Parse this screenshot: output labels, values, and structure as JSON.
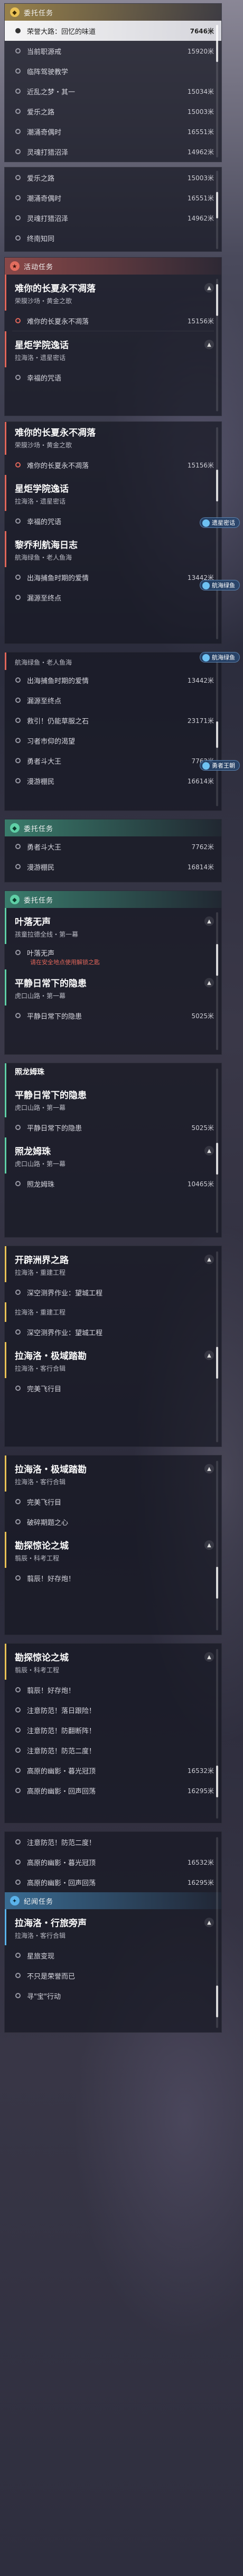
{
  "colors": {
    "daily": "#e9c155",
    "event": "#e26d5e",
    "side": "#5fcfa6",
    "story": "#5ab2ea"
  },
  "s1": {
    "cat": "委托任务",
    "quest_title": "荣誉大路：回忆的味道",
    "steps": [
      {
        "t": "荣誉大路：回忆的味道",
        "d": "7646米",
        "hl": true
      },
      {
        "t": "当前职源戒",
        "d": "15920米"
      },
      {
        "t": "临阵驾驶教学",
        "d": ""
      },
      {
        "t": "近乱之梦・其一",
        "d": "15034米"
      },
      {
        "t": "爱乐之路",
        "d": "15003米"
      },
      {
        "t": "潮涌奇偶时",
        "d": "16551米"
      },
      {
        "t": "灵魂打猎沼泽",
        "d": "14962米"
      }
    ]
  },
  "s2": {
    "steps": [
      {
        "t": "爱乐之路",
        "d": "15003米"
      },
      {
        "t": "潮涌奇偶时",
        "d": "16551米"
      },
      {
        "t": "灵魂打猎沼泽",
        "d": "14962米"
      },
      {
        "t": "终南知同",
        "d": ""
      }
    ]
  },
  "s3": {
    "cat": "活动任务",
    "q1_title": "难你的长夏永不凋落",
    "q1_sub": "荣膜沙场・黄金之歌",
    "q1_step": "难你的长夏永不凋落",
    "q1_dist": "15156米",
    "q2_title": "星炬学院逸话",
    "q2_sub": "拉海洛・遗星密话",
    "q2_step": "幸福的咒语"
  },
  "s4": {
    "q0_title": "难你的长夏永不凋落",
    "q0_sub": "荣膜沙场・黄金之歌",
    "q0_step": "难你的长夏永不凋落",
    "q0_dist": "15156米",
    "q1_title": "星炬学院逸话",
    "q1_sub": "拉海洛・遗星密话",
    "q1_step": "幸福的咒语",
    "tag1": "遗星密话",
    "q2_title": "黎乔利航海日志",
    "q2_sub": "航海绿鱼・老人鱼海",
    "tag2": "航海绿鱼",
    "q2_steps": [
      {
        "t": "出海捕鱼时期的爱情",
        "d": "13442米"
      },
      {
        "t": "漏源至终点",
        "d": ""
      }
    ]
  },
  "s5": {
    "q_sub": "航海绿鱼・老人鱼海",
    "tag": "航海绿鱼",
    "steps": [
      {
        "t": "出海捕鱼时期的爱情",
        "d": "13442米"
      },
      {
        "t": "漏源至终点",
        "d": ""
      },
      {
        "t": "救引！仍能草服之石",
        "d": "23171米"
      },
      {
        "t": "习者市仰的渴望",
        "d": ""
      },
      {
        "t": "勇者斗大王",
        "d": "7762米"
      },
      {
        "t": "漫游棚民",
        "d": "16614米"
      }
    ],
    "tag2": "勇者王朝"
  },
  "s6": {
    "cat": "委托任务",
    "steps": [
      {
        "t": "勇者斗大王",
        "d": "7762米"
      },
      {
        "t": "漫游棚民",
        "d": "16814米"
      }
    ]
  },
  "s7": {
    "cat": "委托任务",
    "q1_title": "叶落无声",
    "q1_sub": "孩童拉德全线・第一幕",
    "q1_step": "叶落无声",
    "q1_warn": "请在安全地点使用解锁之匙",
    "q2_title": "平静日常下的隐患",
    "q2_sub": "虎口山路・第一幕",
    "q2_step": "平静日常下的隐患",
    "q2_dist": "5025米"
  },
  "s8": {
    "q1_title": "照龙姆珠",
    "q2_title": "平静日常下的隐患",
    "q2_sub": "虎口山路・第一幕",
    "q2_step": "平静日常下的隐患",
    "q2_dist": "5025米",
    "q3_title": "照龙姆珠",
    "q3_sub": "虎口山路・第一幕",
    "q3_step": "照龙姆珠",
    "q3_dist": "10465米"
  },
  "s9": {
    "q1_title": "开辟洲界之路",
    "q1_sub": "拉海洛・重建工程",
    "q1_step": "深空测界作业：望城工程",
    "q2_sub": "拉海洛・重建工程",
    "q2_step": "深空测界作业：望城工程",
    "q3_title": "拉海洛・极域踏勘",
    "q3_sub": "拉海洛・客行合辑",
    "q3_step": "完美飞行目"
  },
  "s10": {
    "q1_title": "拉海洛・极域踏勘",
    "q1_sub": "拉海洛・客行合辑",
    "q1_steps": [
      "完美飞行目",
      "破碎期题之心"
    ],
    "q2_title": "勘探惊论之城",
    "q2_sub": "翦辰・科考工程",
    "q2_step": "翦辰！好存炮！"
  },
  "s11": {
    "q_title": "勘探惊论之城",
    "q_sub": "翦辰・科考工程",
    "steps": [
      {
        "t": "翦辰！好存炮！",
        "d": ""
      },
      {
        "t": "注意防范！落日跟险！",
        "d": ""
      },
      {
        "t": "注意防范！防翻断阵！",
        "d": ""
      },
      {
        "t": "注意防范！防范二度！",
        "d": ""
      },
      {
        "t": "高原的幽影・暮光冠顶",
        "d": "16532米"
      },
      {
        "t": "高原的幽影・回声回荡",
        "d": "16295米"
      }
    ]
  },
  "s12": {
    "cat": "纪闻任务",
    "steps": [
      {
        "t": "注意防范！防范二度！",
        "d": ""
      },
      {
        "t": "高原的幽影・暮光冠顶",
        "d": "16532米"
      },
      {
        "t": "高原的幽影・回声回荡",
        "d": "16295米"
      }
    ],
    "q_title": "拉海洛・行旅旁声",
    "q_sub": "拉海洛・客行合辑",
    "q_steps": [
      "星旅变现",
      "不只是荣誉而已",
      "寻\"宝\"行动"
    ]
  }
}
